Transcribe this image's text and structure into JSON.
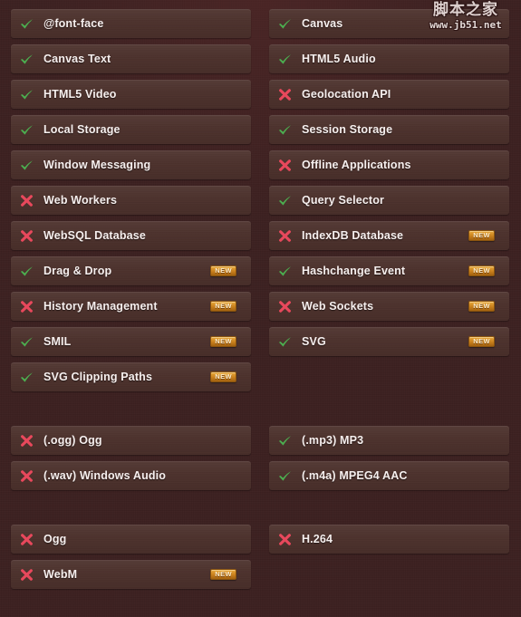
{
  "meta": {
    "page_title": "HTML5 Feature Support List",
    "background_color": "#3c2020",
    "row_color": "#4b302b",
    "supported_color": "#4caf50",
    "unsupported_color": "#e8485c",
    "badge_color": "#c9801d",
    "label_color": "#f6efee"
  },
  "watermark": {
    "name": "脚本之家",
    "url": "www.jb51.net"
  },
  "icons": {
    "supported": "check-icon",
    "unsupported": "cross-icon",
    "badge": "new-badge"
  },
  "badge": {
    "new_label": "NEW"
  },
  "columns": [
    {
      "name": "left-column",
      "groups": [
        {
          "name": "features-group",
          "rows": [
            {
              "label": "@font-face",
              "status": "supported",
              "new": false
            },
            {
              "label": "Canvas Text",
              "status": "supported",
              "new": false
            },
            {
              "label": "HTML5 Video",
              "status": "supported",
              "new": false
            },
            {
              "label": "Local Storage",
              "status": "supported",
              "new": false
            },
            {
              "label": "Window Messaging",
              "status": "supported",
              "new": false
            },
            {
              "label": "Web Workers",
              "status": "unsupported",
              "new": false
            },
            {
              "label": "WebSQL Database",
              "status": "unsupported",
              "new": false
            },
            {
              "label": "Drag & Drop",
              "status": "supported",
              "new": true
            },
            {
              "label": "History Management",
              "status": "unsupported",
              "new": true
            },
            {
              "label": "SMIL",
              "status": "supported",
              "new": true
            },
            {
              "label": "SVG Clipping Paths",
              "status": "supported",
              "new": true
            }
          ]
        },
        {
          "name": "audio-formats-group",
          "gap_before": 38,
          "rows": [
            {
              "label": "(.ogg) Ogg",
              "status": "unsupported",
              "new": false
            },
            {
              "label": "(.wav) Windows Audio",
              "status": "unsupported",
              "new": false
            }
          ]
        },
        {
          "name": "video-formats-group",
          "gap_before": 38,
          "rows": [
            {
              "label": "Ogg",
              "status": "unsupported",
              "new": false
            },
            {
              "label": "WebM",
              "status": "unsupported",
              "new": true
            }
          ]
        }
      ]
    },
    {
      "name": "right-column",
      "groups": [
        {
          "name": "features-group",
          "rows": [
            {
              "label": "Canvas",
              "status": "supported",
              "new": false
            },
            {
              "label": "HTML5 Audio",
              "status": "supported",
              "new": false
            },
            {
              "label": "Geolocation API",
              "status": "unsupported",
              "new": false
            },
            {
              "label": "Session Storage",
              "status": "supported",
              "new": false
            },
            {
              "label": "Offline Applications",
              "status": "unsupported",
              "new": false
            },
            {
              "label": "Query Selector",
              "status": "supported",
              "new": false
            },
            {
              "label": "IndexDB Database",
              "status": "unsupported",
              "new": true
            },
            {
              "label": "Hashchange Event",
              "status": "supported",
              "new": true
            },
            {
              "label": "Web Sockets",
              "status": "unsupported",
              "new": true
            },
            {
              "label": "SVG",
              "status": "supported",
              "new": true
            }
          ]
        },
        {
          "name": "audio-formats-group",
          "gap_before": 77,
          "rows": [
            {
              "label": "(.mp3) MP3",
              "status": "supported",
              "new": false
            },
            {
              "label": "(.m4a) MPEG4 AAC",
              "status": "supported",
              "new": false
            }
          ]
        },
        {
          "name": "video-formats-group",
          "gap_before": 38,
          "rows": [
            {
              "label": "H.264",
              "status": "unsupported",
              "new": false
            }
          ]
        }
      ]
    }
  ]
}
